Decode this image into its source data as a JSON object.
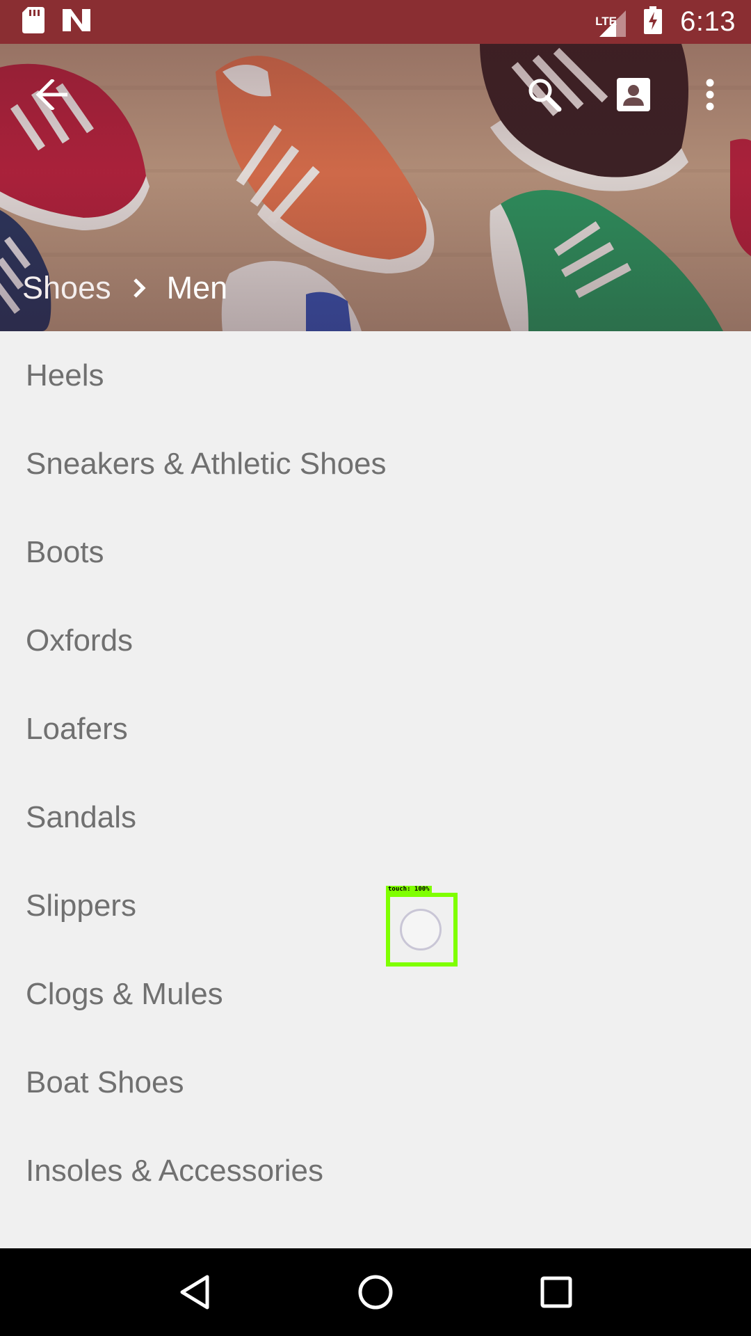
{
  "status_bar": {
    "time": "6:13",
    "network_label": "LTE",
    "icons": [
      "sd-card-icon",
      "notification-n-icon",
      "lte-signal-icon",
      "battery-charging-icon"
    ]
  },
  "header": {
    "breadcrumb": {
      "parent": "Shoes",
      "current": "Men"
    },
    "actions": [
      "back-arrow-icon",
      "search-icon",
      "account-box-icon",
      "more-vert-icon"
    ]
  },
  "categories": [
    {
      "label": "Heels"
    },
    {
      "label": "Sneakers & Athletic Shoes"
    },
    {
      "label": "Boots"
    },
    {
      "label": "Oxfords"
    },
    {
      "label": "Loafers"
    },
    {
      "label": "Sandals"
    },
    {
      "label": "Slippers"
    },
    {
      "label": "Clogs & Mules"
    },
    {
      "label": "Boat Shoes"
    },
    {
      "label": "Insoles & Accessories"
    }
  ],
  "touch_overlay": {
    "label": "touch: 100%"
  },
  "nav_bar": {
    "buttons": [
      "back-triangle-icon",
      "home-circle-icon",
      "recents-square-icon"
    ]
  },
  "colors": {
    "status_bar": "#8a2e32",
    "list_background": "#f0f0f0",
    "list_text": "#707070",
    "touch_highlight": "#7fff00"
  }
}
